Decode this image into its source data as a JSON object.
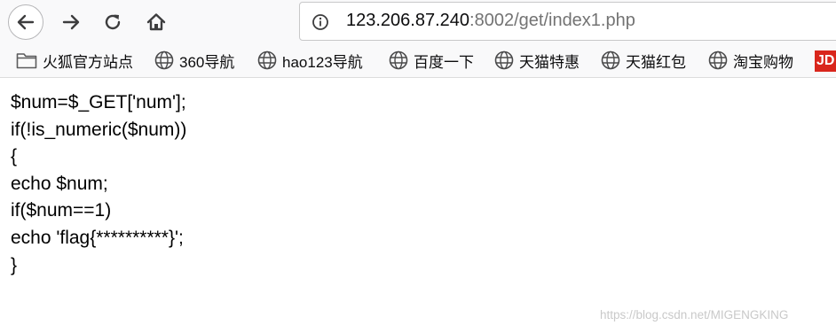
{
  "browser": {
    "url_host": "123.206.87.240",
    "url_rest": ":8002/get/index1.php"
  },
  "bookmarks": [
    {
      "label": "火狐官方站点",
      "icon": "folder-icon"
    },
    {
      "label": "360导航",
      "icon": "globe-icon"
    },
    {
      "label": "hao123导航",
      "icon": "globe-icon"
    },
    {
      "label": "百度一下",
      "icon": "globe-icon"
    },
    {
      "label": "天猫特惠",
      "icon": "globe-icon"
    },
    {
      "label": "天猫红包",
      "icon": "globe-icon"
    },
    {
      "label": "淘宝购物",
      "icon": "globe-icon"
    },
    {
      "label": "JD",
      "icon": "jd-icon"
    }
  ],
  "code_lines": [
    "$num=$_GET['num'];",
    "if(!is_numeric($num))",
    "{",
    "echo $num;",
    "if($num==1)",
    "echo 'flag{**********}';",
    "}"
  ],
  "watermark": "https://blog.csdn.net/MIGENGKING"
}
